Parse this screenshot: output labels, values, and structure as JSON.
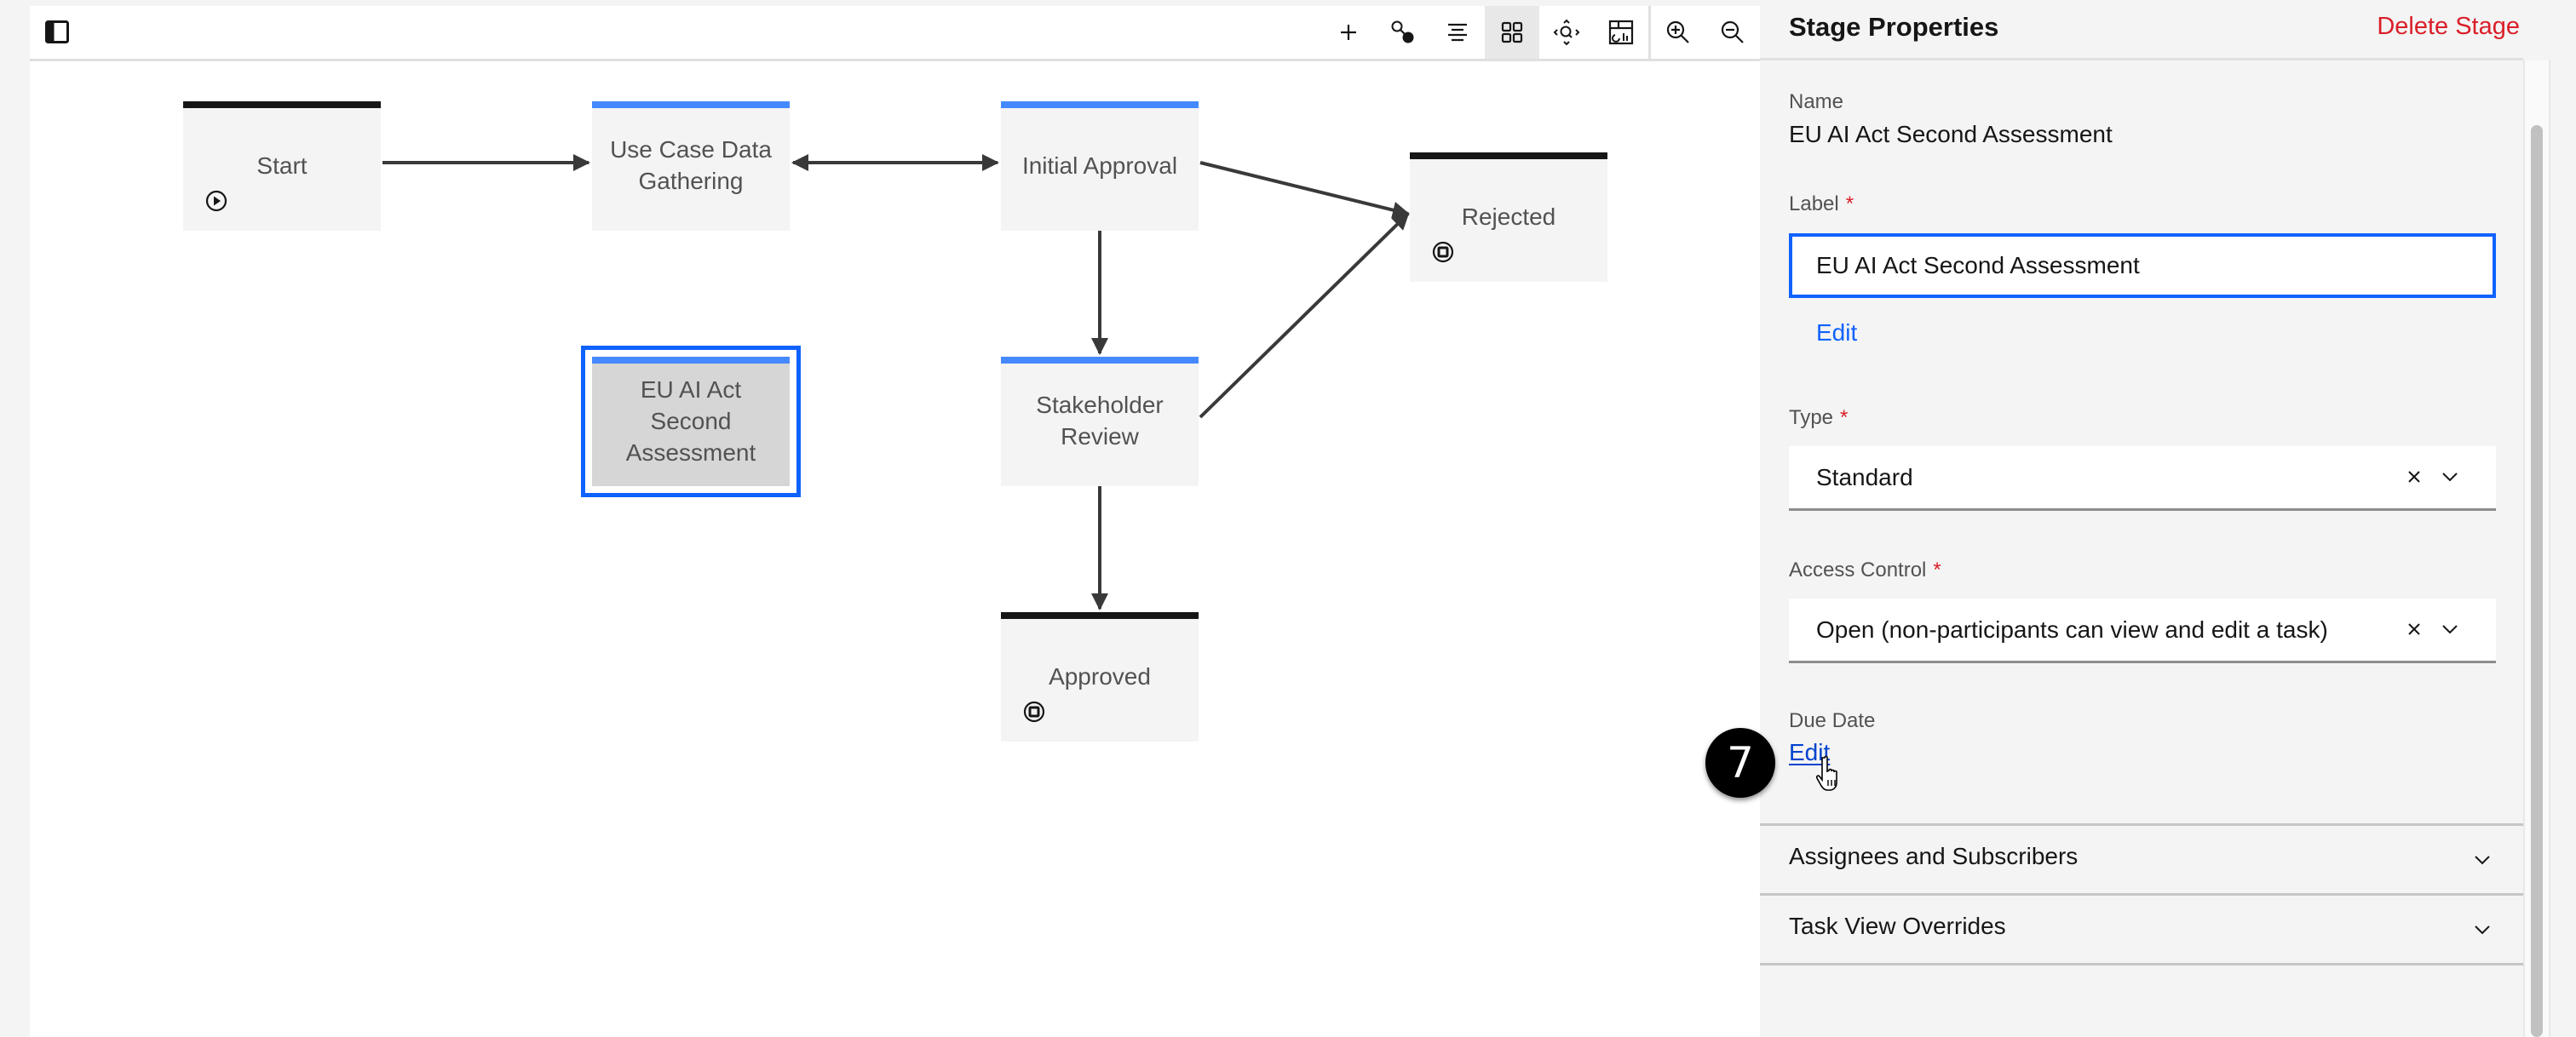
{
  "toolbar": {
    "left_toggle": "sidebar-toggle",
    "buttons": [
      {
        "name": "add",
        "icon": "plus-icon"
      },
      {
        "name": "connect",
        "icon": "connect-icon"
      },
      {
        "name": "align",
        "icon": "align-center-icon"
      },
      {
        "name": "grid",
        "icon": "grid-icon",
        "active": true
      },
      {
        "name": "fit",
        "icon": "fit-to-screen-icon"
      },
      {
        "name": "minimap",
        "icon": "minimap-icon"
      },
      {
        "name": "zoom-in",
        "icon": "zoom-in-icon"
      },
      {
        "name": "zoom-out",
        "icon": "zoom-out-icon"
      }
    ]
  },
  "diagram": {
    "nodes": [
      {
        "id": "start",
        "label": "Start",
        "kind": "start",
        "bar_color": "#161616",
        "icon": "play-icon"
      },
      {
        "id": "use-case",
        "label": "Use Case Data Gathering",
        "kind": "stage",
        "bar_color": "#4589ff"
      },
      {
        "id": "initial",
        "label": "Initial Approval",
        "kind": "stage",
        "bar_color": "#4589ff"
      },
      {
        "id": "rejected",
        "label": "Rejected",
        "kind": "end",
        "bar_color": "#161616",
        "icon": "stop-icon"
      },
      {
        "id": "eu-ai",
        "label": "EU AI Act Second Assessment",
        "kind": "stage",
        "bar_color": "#4589ff",
        "selected": true
      },
      {
        "id": "stakeholder",
        "label": "Stakeholder Review",
        "kind": "stage",
        "bar_color": "#4589ff"
      },
      {
        "id": "approved",
        "label": "Approved",
        "kind": "end",
        "bar_color": "#161616",
        "icon": "stop-icon"
      }
    ],
    "edges": [
      {
        "from": "start",
        "to": "use-case"
      },
      {
        "from": "use-case",
        "to": "initial",
        "bidirectional": true
      },
      {
        "from": "initial",
        "to": "rejected"
      },
      {
        "from": "initial",
        "to": "stakeholder"
      },
      {
        "from": "stakeholder",
        "to": "rejected"
      },
      {
        "from": "stakeholder",
        "to": "approved"
      }
    ]
  },
  "panel": {
    "title": "Stage Properties",
    "delete_label": "Delete Stage",
    "name_label": "Name",
    "name_value": "EU AI Act Second Assessment",
    "label_label": "Label",
    "label_value": "EU AI Act Second Assessment",
    "label_edit": "Edit",
    "type_label": "Type",
    "type_value": "Standard",
    "access_label": "Access Control",
    "access_value": "Open (non-participants can view and edit a task)",
    "due_label": "Due Date",
    "due_edit": "Edit",
    "required_mark": "*",
    "accordions": [
      {
        "label": "Assignees and Subscribers"
      },
      {
        "label": "Task View Overrides"
      }
    ]
  },
  "annotation": {
    "step": "7"
  },
  "colors": {
    "accent": "#0f62fe",
    "danger": "#da1e28",
    "stage_bar": "#4589ff",
    "terminal_bar": "#161616"
  }
}
